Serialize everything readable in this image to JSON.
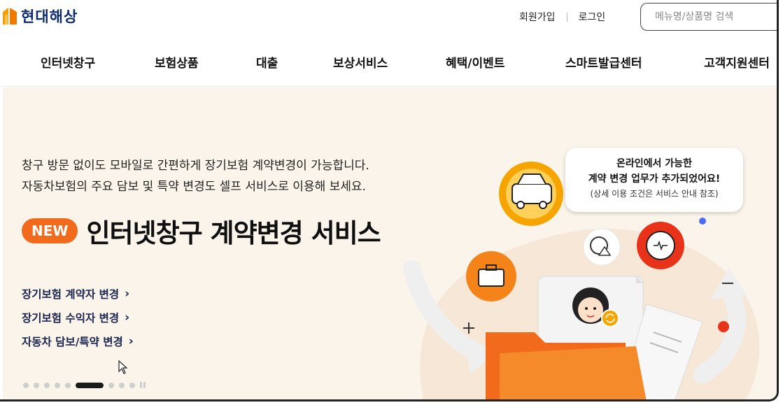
{
  "header": {
    "logo_text": "현대해상",
    "signup_label": "회원가입",
    "login_label": "로그인",
    "search_placeholder": "메뉴명/상품명 검색"
  },
  "nav": {
    "items": [
      "인터넷창구",
      "보험상품",
      "대출",
      "보상서비스",
      "혜택/이벤트",
      "스마트발급센터",
      "고객지원센터"
    ]
  },
  "hero": {
    "desc_line1": "창구 방문 없이도 모바일로 간편하게 장기보험 계약변경이 가능합니다.",
    "desc_line2": "자동차보험의 주요 담보 및 특약 변경도 셀프 서비스로 이용해 보세요.",
    "badge": "NEW",
    "title": "인터넷창구 계약변경 서비스",
    "links": [
      {
        "label": "장기보험 계약자 변경"
      },
      {
        "label": "장기보험 수익자 변경"
      },
      {
        "label": "자동차 담보/특약 변경"
      }
    ],
    "bubble_line1": "온라인에서 가능한",
    "bubble_line2": "계약 변경 업무가 추가되었어요!",
    "bubble_line3": "(상세 이용 조건은 서비스 안내 참조)"
  },
  "carousel": {
    "slide_count": 10,
    "active_index": 5
  },
  "colors": {
    "brand": "#f26a1b",
    "logo": "#0d2a6e",
    "hero_bg": "#fbf4ea"
  }
}
